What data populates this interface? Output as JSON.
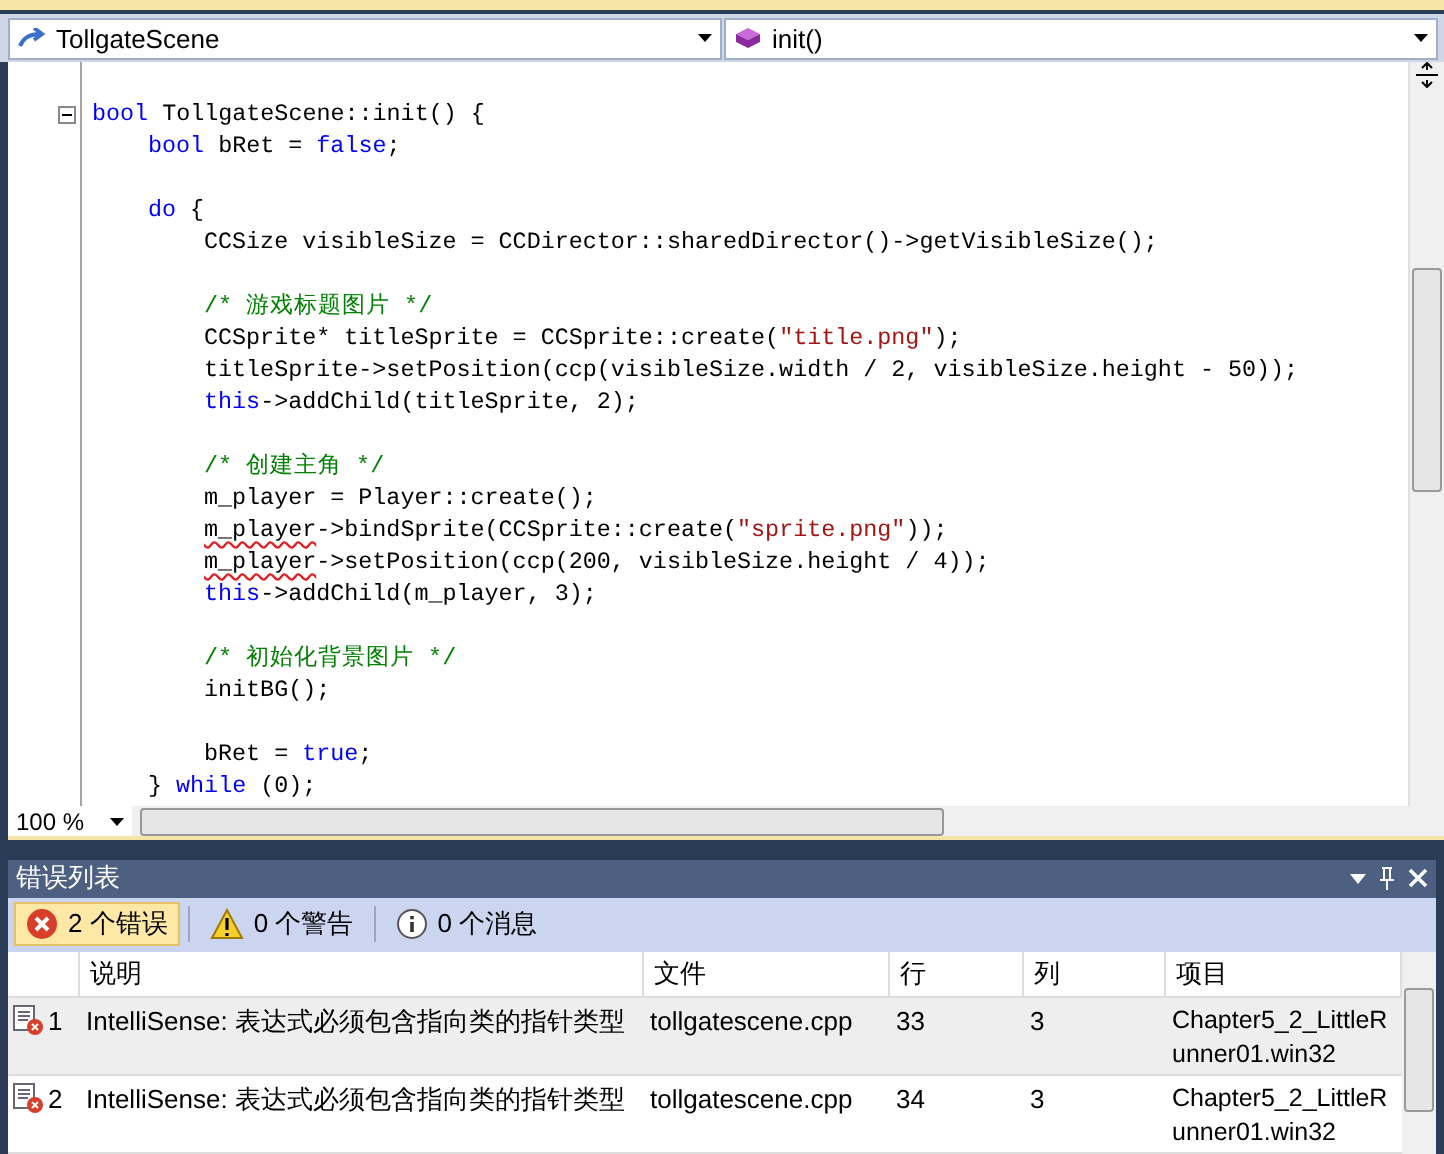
{
  "navigation": {
    "class_scope": "TollgateScene",
    "member": "init()"
  },
  "code_lines": [
    {
      "fold": true,
      "segments": [
        {
          "text": "bool",
          "kind": "keyword"
        },
        {
          "text": " TollgateScene::init() {",
          "kind": "plain"
        }
      ],
      "children": [
        {
          "fold": false,
          "segments": [
            {
              "text": "bool",
              "kind": "keyword"
            },
            {
              "text": " bRet = ",
              "kind": "plain"
            },
            {
              "text": "false",
              "kind": "keyword"
            },
            {
              "text": ";",
              "kind": "plain"
            }
          ]
        },
        {
          "fold": false
        },
        {
          "fold": false,
          "segments": [
            {
              "text": "do",
              "kind": "keyword"
            },
            {
              "text": " {",
              "kind": "plain"
            }
          ],
          "children": [
            {
              "fold": false,
              "segments": [
                {
                  "text": "CCSize visibleSize = CCDirector::sharedDirector()->getVisibleSize();",
                  "kind": "plain"
                }
              ]
            },
            {
              "fold": false
            },
            {
              "fold": false,
              "segments": [
                {
                  "text": "/* 游戏标题图片 */",
                  "kind": "comment"
                }
              ]
            },
            {
              "fold": false,
              "segments": [
                {
                  "text": "CCSprite* titleSprite = CCSprite::create(",
                  "kind": "plain"
                },
                {
                  "text": "\"title.png\"",
                  "kind": "string"
                },
                {
                  "text": ");",
                  "kind": "plain"
                }
              ]
            },
            {
              "fold": false,
              "segments": [
                {
                  "text": "titleSprite->setPosition(ccp(visibleSize.width / 2, visibleSize.height - 50));",
                  "kind": "plain"
                }
              ]
            },
            {
              "fold": false,
              "segments": [
                {
                  "text": "this",
                  "kind": "keyword"
                },
                {
                  "text": "->addChild(titleSprite, 2);",
                  "kind": "plain"
                }
              ]
            },
            {
              "fold": false
            },
            {
              "fold": false,
              "segments": [
                {
                  "text": "/* 创建主角 */",
                  "kind": "comment"
                }
              ]
            },
            {
              "fold": false,
              "segments": [
                {
                  "text": "m_player = Player::create();",
                  "kind": "plain"
                }
              ]
            },
            {
              "fold": false,
              "segments": [
                {
                  "text": "m_player",
                  "kind": "error"
                },
                {
                  "text": "->bindSprite(CCSprite::create(",
                  "kind": "plain"
                },
                {
                  "text": "\"sprite.png\"",
                  "kind": "string"
                },
                {
                  "text": "));",
                  "kind": "plain"
                }
              ]
            },
            {
              "fold": false,
              "segments": [
                {
                  "text": "m_player",
                  "kind": "error"
                },
                {
                  "text": "->setPosition(ccp(200, visibleSize.height / 4));",
                  "kind": "plain"
                }
              ]
            },
            {
              "fold": false,
              "segments": [
                {
                  "text": "this",
                  "kind": "keyword"
                },
                {
                  "text": "->addChild(m_player, 3);",
                  "kind": "plain"
                }
              ]
            },
            {
              "fold": false
            },
            {
              "fold": false,
              "segments": [
                {
                  "text": "/* 初始化背景图片 */",
                  "kind": "comment"
                }
              ]
            },
            {
              "fold": false,
              "segments": [
                {
                  "text": "initBG();",
                  "kind": "plain"
                }
              ]
            },
            {
              "fold": false
            },
            {
              "fold": false,
              "segments": [
                {
                  "text": "bRet = ",
                  "kind": "plain"
                },
                {
                  "text": "true",
                  "kind": "keyword"
                },
                {
                  "text": ";",
                  "kind": "plain"
                }
              ]
            }
          ]
        },
        {
          "fold": false,
          "segments": [
            {
              "text": "} ",
              "kind": "plain"
            },
            {
              "text": "while",
              "kind": "keyword"
            },
            {
              "text": " (0);",
              "kind": "plain"
            }
          ]
        }
      ]
    }
  ],
  "zoom": "100 %",
  "error_list": {
    "title": "错误列表",
    "filters": [
      {
        "kind": "error",
        "label": "2 个错误",
        "selected": true
      },
      {
        "kind": "warning",
        "label": "0 个警告",
        "selected": false
      },
      {
        "kind": "message",
        "label": "0 个消息",
        "selected": false
      }
    ],
    "columns": [
      "说明",
      "文件",
      "行",
      "列",
      "项目"
    ],
    "rows": [
      {
        "number": "1",
        "description": "IntelliSense: 表达式必须包含指向类的指针类型",
        "file": "tollgatescene.cpp",
        "line": "33",
        "column": "3",
        "project": "Chapter5_2_LittleRunner01.win32",
        "selected": true
      },
      {
        "number": "2",
        "description": "IntelliSense: 表达式必须包含指向类的指针类型",
        "file": "tollgatescene.cpp",
        "line": "34",
        "column": "3",
        "project": "Chapter5_2_LittleRunner01.win32",
        "selected": false
      }
    ]
  }
}
